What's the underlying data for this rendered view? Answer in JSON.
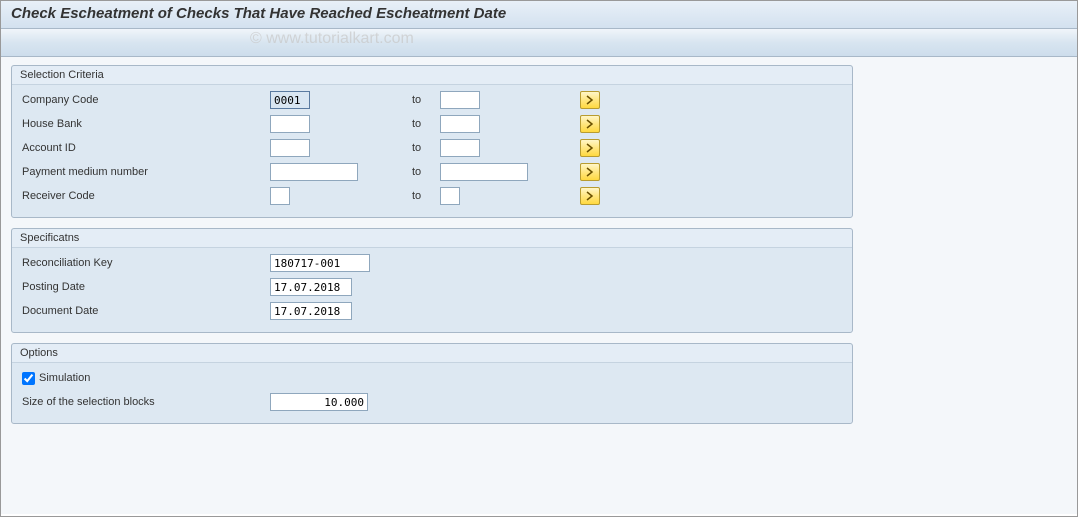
{
  "page_title": "Check Escheatment of Checks That Have Reached Escheatment Date",
  "watermark": "© www.tutorialkart.com",
  "groups": {
    "selection": {
      "title": "Selection Criteria",
      "rows": {
        "company_code": {
          "label": "Company Code",
          "from": "0001",
          "to_label": "to",
          "to": ""
        },
        "house_bank": {
          "label": "House Bank",
          "from": "",
          "to_label": "to",
          "to": ""
        },
        "account_id": {
          "label": "Account ID",
          "from": "",
          "to_label": "to",
          "to": ""
        },
        "payment_medium": {
          "label": "Payment medium number",
          "from": "",
          "to_label": "to",
          "to": ""
        },
        "receiver_code": {
          "label": "Receiver Code",
          "from": "",
          "to_label": "to",
          "to": ""
        }
      }
    },
    "specs": {
      "title": "Specificatns",
      "rows": {
        "recon_key": {
          "label": "Reconciliation Key",
          "value": "180717-001"
        },
        "posting_date": {
          "label": "Posting Date",
          "value": "17.07.2018"
        },
        "document_date": {
          "label": "Document Date",
          "value": "17.07.2018"
        }
      }
    },
    "options": {
      "title": "Options",
      "rows": {
        "simulation": {
          "label": "Simulation",
          "checked": true
        },
        "block_size": {
          "label": "Size of the selection blocks",
          "value": "10.000"
        }
      }
    }
  }
}
